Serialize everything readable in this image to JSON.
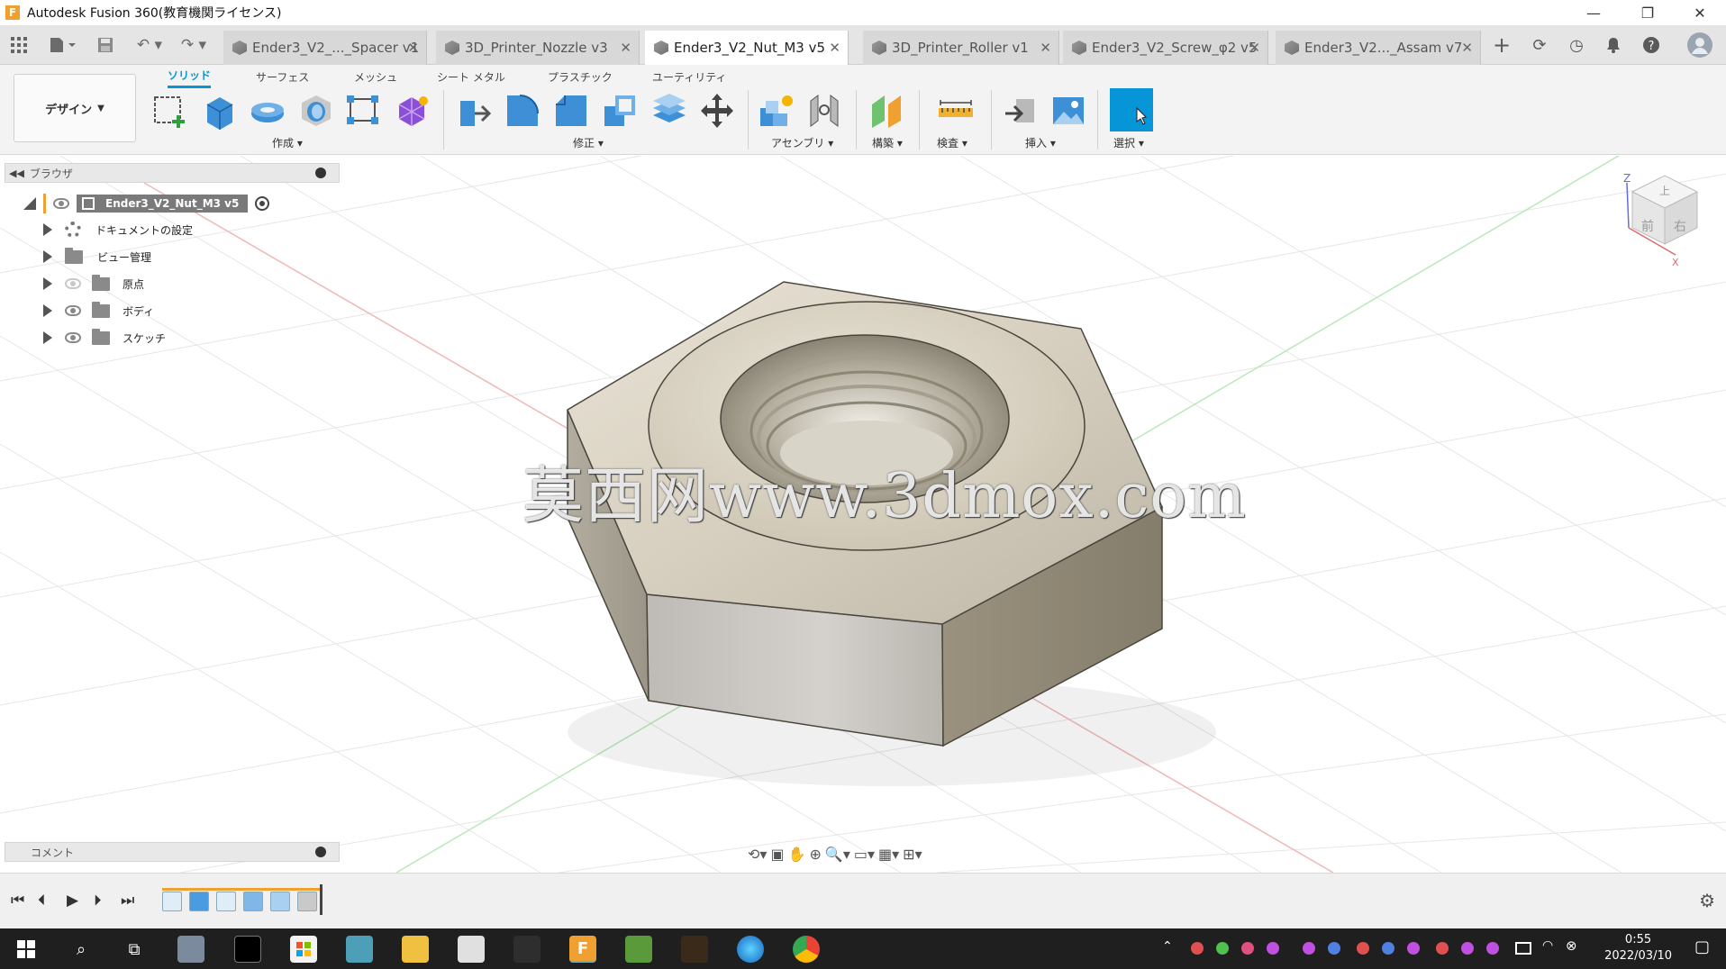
{
  "window": {
    "title": "Autodesk Fusion 360(教育機関ライセンス)",
    "minimize": "—",
    "maximize": "❐",
    "close": "✕"
  },
  "tabs": [
    {
      "label": "Ender3_V2_..._Spacer v1",
      "active": false
    },
    {
      "label": "3D_Printer_Nozzle v3",
      "active": false
    },
    {
      "label": "Ender3_V2_Nut_M3 v5",
      "active": true
    },
    {
      "label": "3D_Printer_Roller v1",
      "active": false
    },
    {
      "label": "Ender3_V2_Screw_φ2 v5",
      "active": false
    },
    {
      "label": "Ender3_V2..._Assam v7",
      "active": false
    }
  ],
  "toolbar": {
    "workspace": "デザイン",
    "ribbon_tabs": [
      "ソリッド",
      "サーフェス",
      "メッシュ",
      "シート メタル",
      "プラスチック",
      "ユーティリティ"
    ],
    "groups": {
      "create": "作成",
      "modify": "修正",
      "assembly": "アセンブリ",
      "construct": "構築",
      "inspect": "検査",
      "insert": "挿入",
      "select": "選択"
    }
  },
  "browser": {
    "header": "ブラウザ",
    "root": "Ender3_V2_Nut_M3 v5",
    "items": [
      {
        "label": "ドキュメントの設定",
        "icon": "gear-icon"
      },
      {
        "label": "ビュー管理",
        "icon": "folder-icon"
      },
      {
        "label": "原点",
        "icon": "folder-icon"
      },
      {
        "label": "ボディ",
        "icon": "folder-icon"
      },
      {
        "label": "スケッチ",
        "icon": "folder-icon"
      }
    ]
  },
  "comments": {
    "header": "コメント"
  },
  "viewcube": {
    "top": "上",
    "front": "前",
    "right": "右",
    "axis_z": "Z",
    "axis_x": "X"
  },
  "watermark": "莫西网www.3dmox.com",
  "taskbar": {
    "time": "0:55",
    "date": "2022/03/10"
  },
  "colors": {
    "accent": "#0696d7",
    "tabbar": "#e5e5e5",
    "toolbar": "#f3f3f3",
    "taskbar": "#1f1f1f"
  }
}
